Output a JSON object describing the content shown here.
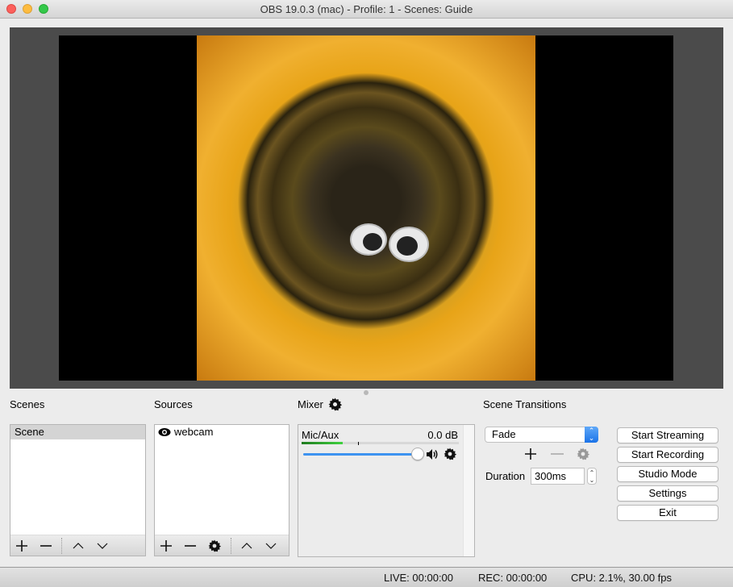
{
  "window": {
    "title": "OBS 19.0.3 (mac) - Profile: 1 - Scenes: Guide"
  },
  "preview": {
    "description": "Sunflower close-up webcam preview with googly eyes"
  },
  "scenes": {
    "title": "Scenes",
    "items": [
      {
        "label": "Scene",
        "selected": true
      }
    ],
    "toolbar": [
      "add-icon",
      "remove-icon",
      "move-up-icon",
      "move-down-icon"
    ]
  },
  "sources": {
    "title": "Sources",
    "items": [
      {
        "label": "webcam",
        "visible": true,
        "icon": "eye-icon"
      }
    ],
    "toolbar": [
      "add-icon",
      "remove-icon",
      "gear-icon",
      "move-up-icon",
      "move-down-icon"
    ]
  },
  "mixer": {
    "title": "Mixer",
    "channels": [
      {
        "name": "Mic/Aux",
        "level_label": "0.0 dB",
        "meter_fraction": 0.26,
        "volume_fraction": 1.0
      }
    ]
  },
  "transitions": {
    "title": "Scene Transitions",
    "selected": "Fade",
    "duration_label": "Duration",
    "duration_value": "300ms"
  },
  "controls": {
    "start_streaming": "Start Streaming",
    "start_recording": "Start Recording",
    "studio_mode": "Studio Mode",
    "settings": "Settings",
    "exit": "Exit"
  },
  "status": {
    "live": "LIVE: 00:00:00",
    "rec": "REC: 00:00:00",
    "cpu": "CPU: 2.1%, 30.00 fps"
  },
  "colors": {
    "accent": "#1b73e8",
    "meter_green": "#2a8a2a",
    "slider_blue": "#3d93f0"
  }
}
